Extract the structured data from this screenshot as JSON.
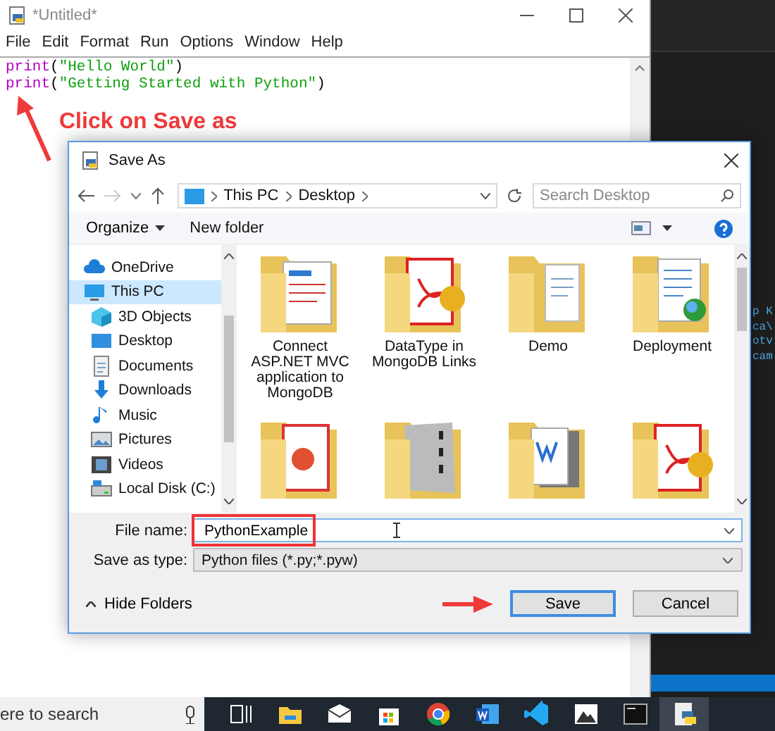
{
  "editor": {
    "title": "*Untitled*",
    "menu": [
      "File",
      "Edit",
      "Format",
      "Run",
      "Options",
      "Window",
      "Help"
    ],
    "code_lines": [
      [
        {
          "kind": "keyword",
          "text": "print"
        },
        {
          "kind": "punct",
          "text": "("
        },
        {
          "kind": "string",
          "text": "\"Hello World\""
        },
        {
          "kind": "punct",
          "text": ")"
        }
      ],
      [
        {
          "kind": "keyword",
          "text": "print"
        },
        {
          "kind": "punct",
          "text": "("
        },
        {
          "kind": "string",
          "text": "\"Getting Started with Python\""
        },
        {
          "kind": "punct",
          "text": ")"
        }
      ]
    ],
    "callout": "Click on Save as"
  },
  "background_fragments": [
    "p K",
    "ca\\",
    "otv",
    "cam"
  ],
  "dialog": {
    "title": "Save As",
    "breadcrumb": [
      "This PC",
      "Desktop"
    ],
    "search": {
      "placeholder": "Search Desktop"
    },
    "toolbar": {
      "organize": "Organize",
      "new_folder": "New folder"
    },
    "sidebar": [
      {
        "label": "OneDrive",
        "kind": "cloud",
        "selected": false
      },
      {
        "label": "This PC",
        "kind": "pc",
        "selected": true,
        "children": [
          {
            "label": "3D Objects",
            "kind": "cube",
            "selected": false
          },
          {
            "label": "Desktop",
            "kind": "desktop",
            "selected": false
          },
          {
            "label": "Documents",
            "kind": "docs",
            "selected": false
          },
          {
            "label": "Downloads",
            "kind": "download",
            "selected": false
          },
          {
            "label": "Music",
            "kind": "music",
            "selected": false
          },
          {
            "label": "Pictures",
            "kind": "pictures",
            "selected": false
          },
          {
            "label": "Videos",
            "kind": "videos",
            "selected": false
          },
          {
            "label": "Local Disk (C:)",
            "kind": "disk",
            "selected": false
          }
        ]
      }
    ],
    "files": [
      {
        "label": "Connect ASP.NET MVC application to MongoDB",
        "kind": "page"
      },
      {
        "label": "DataType in MongoDB Links",
        "kind": "pdf"
      },
      {
        "label": "Demo",
        "kind": "plain"
      },
      {
        "label": "Deployment",
        "kind": "web"
      },
      {
        "kind": "slides"
      },
      {
        "kind": "scan"
      },
      {
        "kind": "word"
      },
      {
        "kind": "pdf"
      }
    ],
    "file_name": {
      "label": "File name:",
      "value": "PythonExample",
      "highlighted": true
    },
    "save_as_type": {
      "label": "Save as type:",
      "value": "Python files (*.py;*.pyw)"
    },
    "hide_folders": "Hide Folders",
    "buttons": [
      {
        "label": "Save",
        "default": true
      },
      {
        "label": "Cancel",
        "default": false
      }
    ]
  },
  "taskbar": {
    "search_text": "ere to search",
    "apps": [
      {
        "kind": "taskview",
        "active": false
      },
      {
        "kind": "explorer",
        "active": false
      },
      {
        "kind": "mail",
        "active": false
      },
      {
        "kind": "store",
        "active": false
      },
      {
        "kind": "chrome",
        "active": false
      },
      {
        "kind": "word",
        "active": false
      },
      {
        "kind": "vscode",
        "active": false
      },
      {
        "kind": "photos",
        "active": false
      },
      {
        "kind": "terminal",
        "active": false
      },
      {
        "kind": "python",
        "active": true
      }
    ]
  }
}
